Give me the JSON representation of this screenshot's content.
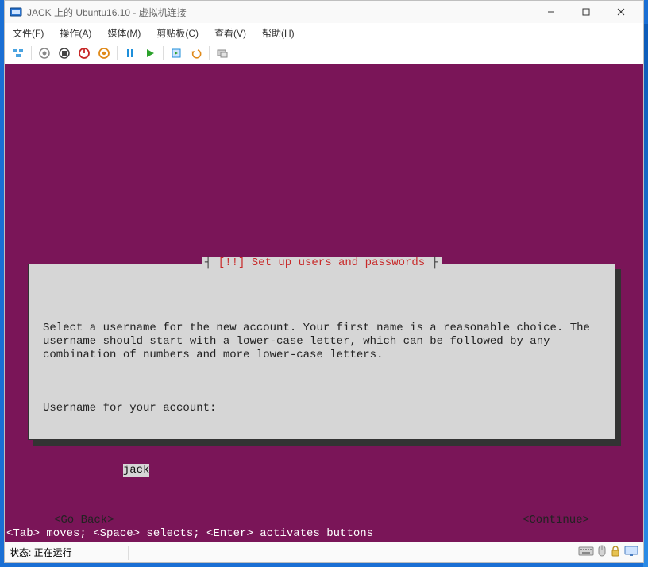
{
  "window": {
    "title": "JACK 上的 Ubuntu16.10 - 虚拟机连接"
  },
  "menu": {
    "file": "文件(F)",
    "action": "操作(A)",
    "media": "媒体(M)",
    "clipboard": "剪贴板(C)",
    "view": "查看(V)",
    "help": "帮助(H)"
  },
  "toolbar_icons": {
    "connect": "connect-icon",
    "power_on": "power-on-icon",
    "power_off": "power-off-icon",
    "shutdown": "shutdown-icon",
    "save": "save-icon",
    "pause": "pause-icon",
    "start": "start-icon",
    "checkpoint": "checkpoint-icon",
    "revert": "revert-icon",
    "enhanced": "enhanced-icon"
  },
  "installer": {
    "title": "[!!] Set up users and passwords",
    "description": "Select a username for the new account. Your first name is a reasonable choice. The username should start with a lower-case letter, which can be followed by any combination of numbers and more lower-case letters.",
    "prompt": "Username for your account:",
    "username_value": "jack",
    "go_back": "<Go Back>",
    "continue": "<Continue>"
  },
  "hints": "<Tab> moves; <Space> selects; <Enter> activates buttons",
  "status": {
    "label": "状态: 正在运行"
  }
}
